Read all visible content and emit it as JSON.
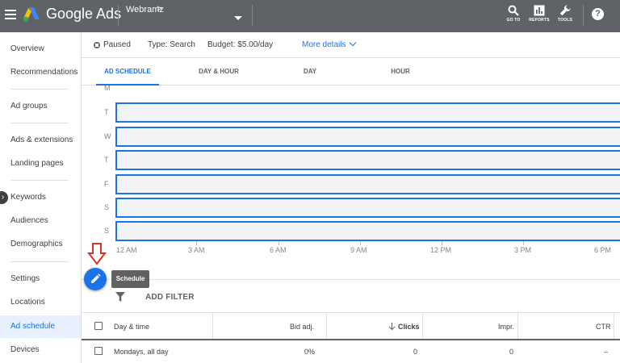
{
  "app": {
    "name": "Google Ads",
    "account": "Webramz",
    "account_chevron": ">"
  },
  "tools": [
    {
      "label": "GO TO",
      "icon": "search-icon"
    },
    {
      "label": "REPORTS",
      "icon": "reports-icon"
    },
    {
      "label": "TOOLS",
      "icon": "wrench-icon"
    }
  ],
  "help": {
    "label": "?"
  },
  "sidebar": {
    "items": [
      {
        "label": "Overview"
      },
      {
        "label": "Recommendations"
      },
      {
        "label": "Ad groups"
      },
      {
        "label": "Ads & extensions"
      },
      {
        "label": "Landing pages"
      },
      {
        "label": "Keywords"
      },
      {
        "label": "Audiences"
      },
      {
        "label": "Demographics"
      },
      {
        "label": "Settings"
      },
      {
        "label": "Locations"
      },
      {
        "label": "Ad schedule",
        "active": true
      },
      {
        "label": "Devices"
      }
    ]
  },
  "status": {
    "state": "Paused",
    "type": "Type: Search",
    "budget": "Budget: $5.00/day",
    "more": "More details"
  },
  "tabs": [
    {
      "label": "AD SCHEDULE",
      "active": true
    },
    {
      "label": "DAY & HOUR"
    },
    {
      "label": "DAY"
    },
    {
      "label": "HOUR"
    }
  ],
  "schedule": {
    "days": [
      "M",
      "T",
      "W",
      "T",
      "F",
      "S",
      "S"
    ],
    "hours": [
      "12 AM",
      "3 AM",
      "6 AM",
      "9 AM",
      "12 PM",
      "3 PM",
      "6 PM"
    ]
  },
  "fab": {
    "tooltip": "Schedule"
  },
  "filter": {
    "label": "ADD FILTER"
  },
  "table": {
    "headers": {
      "day_time": "Day & time",
      "bid_adj": "Bid adj.",
      "clicks": "Clicks",
      "impr": "Impr.",
      "ctr": "CTR"
    },
    "rows": [
      {
        "day_time": "Mondays, all day",
        "bid_adj": "0%",
        "clicks": "0",
        "impr": "0",
        "ctr": "–"
      }
    ]
  },
  "colors": {
    "accent": "#1a73e8",
    "topbar": "#5f6368",
    "annotation": "#d93025"
  }
}
